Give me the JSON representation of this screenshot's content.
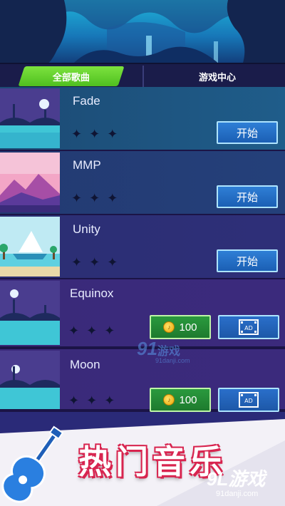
{
  "tabs": {
    "all_songs": "全部歌曲",
    "game_center": "游戏中心"
  },
  "colors": {
    "active_tab": "#6fd63a",
    "start_button": "#2a74cf",
    "coin_button": "#2a9a3e",
    "promo_text_outline": "#d8244f"
  },
  "songs": [
    {
      "title": "Fade",
      "action": "开始",
      "stars": 3,
      "thumb": "bridge-moon"
    },
    {
      "title": "MMP",
      "action": "开始",
      "stars": 3,
      "thumb": "pink-mountains"
    },
    {
      "title": "Unity",
      "action": "开始",
      "stars": 3,
      "thumb": "sailboat"
    },
    {
      "title": "Equinox",
      "price": "100",
      "stars": 3,
      "thumb": "bridge-moon",
      "ad_icon": "film-ad-icon",
      "ad_label": "AD"
    },
    {
      "title": "Moon",
      "price": "100",
      "stars": 3,
      "thumb": "bridge-moon",
      "ad_icon": "film-ad-icon",
      "ad_label": "AD"
    }
  ],
  "promo": {
    "text": "热门音乐",
    "icon": "guitar-icon"
  },
  "watermarks": {
    "center_logo": "91",
    "center_cn": "游戏",
    "center_url": "91danji.com",
    "bottom_logo": "9L游戏",
    "bottom_url": "91danji.com"
  }
}
